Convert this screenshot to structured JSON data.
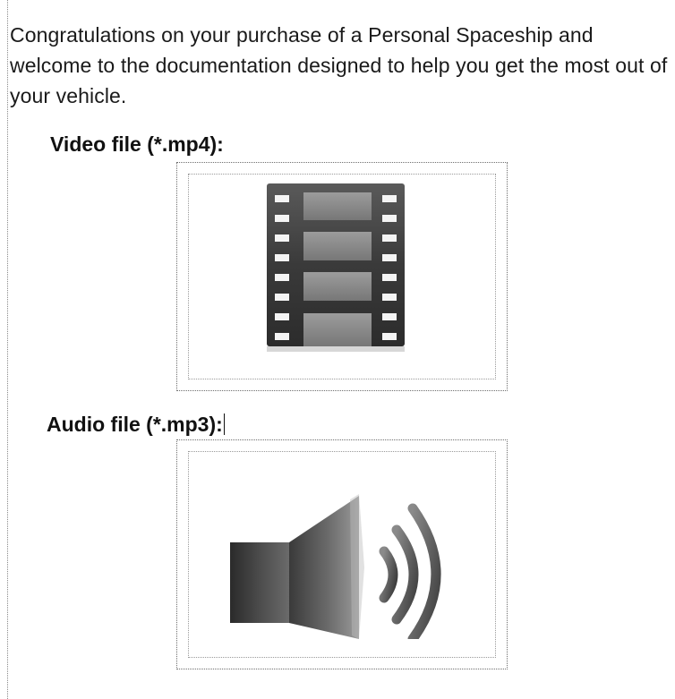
{
  "document": {
    "intro_text": "Congratulations on your purchase of a Personal Spaceship and welcome to the documentation designed to help you get the most out of your vehicle.",
    "video_heading": "Video file (*.mp4):",
    "audio_heading": "Audio file (*.mp3):"
  },
  "icons": {
    "video": "film-strip-icon",
    "audio": "speaker-icon"
  },
  "colors": {
    "text": "#111111",
    "film_dark": "#3c3c3c",
    "film_frame": "#8a8a8a",
    "speaker": "#4a4a4a"
  }
}
